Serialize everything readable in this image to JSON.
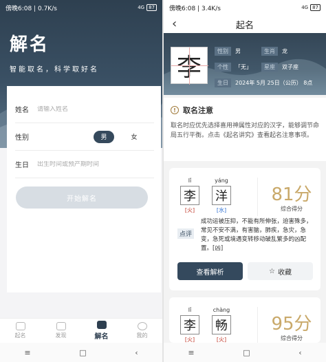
{
  "left": {
    "status": {
      "time": "傍晚6:08",
      "speed": "0.7K/s",
      "signal": "4G",
      "battery": "87"
    },
    "hero": {
      "title": "解名",
      "subtitle": "智能取名，科学取好名"
    },
    "form": {
      "name_label": "姓名",
      "name_placeholder": "请输入姓名",
      "gender_label": "性别",
      "gender_male": "男",
      "gender_female": "女",
      "birth_label": "生日",
      "birth_placeholder": "出生时间或预产期时间",
      "submit": "开始解名"
    },
    "tabs": [
      {
        "label": "起名",
        "icon": "naming-icon"
      },
      {
        "label": "发现",
        "icon": "discover-icon"
      },
      {
        "label": "解名",
        "icon": "analyze-icon"
      },
      {
        "label": "我的",
        "icon": "profile-icon"
      }
    ]
  },
  "right": {
    "status": {
      "time": "傍晚6:08",
      "speed": "3.4K/s",
      "signal": "4G",
      "battery": "87"
    },
    "title": "起名",
    "profile": {
      "surname": "李",
      "rows": [
        [
          {
            "k": "性别",
            "v": "男"
          },
          {
            "k": "生肖",
            "v": "龙"
          }
        ],
        [
          {
            "k": "个性",
            "v": "「无」"
          },
          {
            "k": "星座",
            "v": "双子座"
          }
        ],
        [
          {
            "k": "生日",
            "v": "2024年 5月 25日（公历） 8点"
          }
        ]
      ]
    },
    "note": {
      "title": "取名注意",
      "body": "取名时应优先选择喜用神属性对应的汉字，能够调节命局五行平衡。点击《起名讲究》查看起名注意事项。"
    },
    "names": [
      {
        "chars": [
          {
            "pinyin": "lǐ",
            "hanzi": "李",
            "element": "[火]",
            "color": "#c0392b"
          },
          {
            "pinyin": "yáng",
            "hanzi": "洋",
            "element": "[水]",
            "color": "#2e6fd1"
          }
        ],
        "score": "81分",
        "score_label": "综合得分",
        "comment_badge": "点评",
        "comment": "成功运被压抑，不能有所伸张，迫害殊多，常见不安不满，有害脑，肺疾，急灾，急变，急死或境遇变转移动破乱繁多的凶配置。[凶]",
        "detail_btn": "查看解析",
        "fav_btn": "收藏"
      },
      {
        "chars": [
          {
            "pinyin": "lǐ",
            "hanzi": "李",
            "element": "[火]",
            "color": "#c0392b"
          },
          {
            "pinyin": "chàng",
            "hanzi": "畅",
            "element": "[火]",
            "color": "#c0392b"
          }
        ],
        "score": "95分",
        "score_label": "综合得分"
      }
    ]
  },
  "nav": {
    "menu": "≡",
    "home": "□",
    "back": "‹"
  }
}
